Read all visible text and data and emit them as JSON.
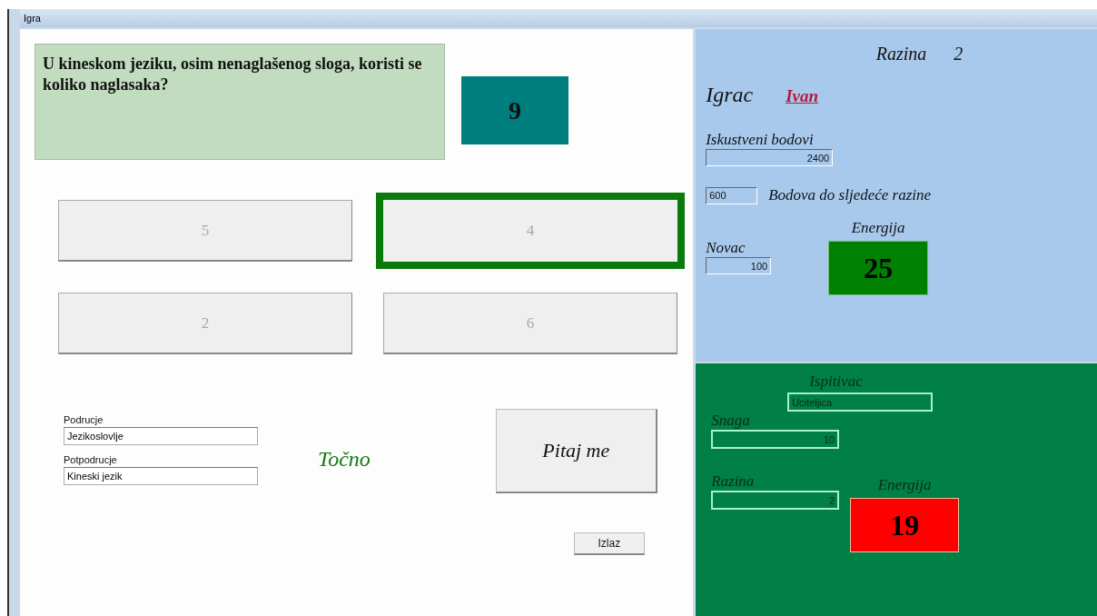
{
  "window": {
    "title": "Igra"
  },
  "question": {
    "text": "U kineskom jeziku, osim nenaglašenog sloga, koristi se koliko naglasaka?",
    "timer": "9"
  },
  "answers": [
    {
      "label": "5",
      "selected": false,
      "disabled": true
    },
    {
      "label": "4",
      "selected": true,
      "disabled": true
    },
    {
      "label": "2",
      "selected": false,
      "disabled": true
    },
    {
      "label": "6",
      "selected": false,
      "disabled": true
    }
  ],
  "area": {
    "label": "Podrucje",
    "value": "Jezikoslovlje"
  },
  "subarea": {
    "label": "Potpodrucje",
    "value": "Kineski jezik"
  },
  "result": "Točno",
  "ask_button": "Pitaj me",
  "exit_button": "Izlaz",
  "player": {
    "level_label": "Razina",
    "level": "2",
    "player_label": "Igrac",
    "name": "Ivan",
    "xp_label": "Iskustveni bodovi",
    "xp": "2400",
    "remaining": "600",
    "remaining_label": "Bodova do sljedeće razine",
    "money_label": "Novac",
    "money": "100",
    "energy_label": "Energija",
    "energy": "25"
  },
  "examiner": {
    "title": "Ispitivac",
    "name": "Uciteljica",
    "strength_label": "Snaga",
    "strength": "10",
    "level_label": "Razina",
    "level": "2",
    "energy_label": "Energija",
    "energy": "19"
  }
}
